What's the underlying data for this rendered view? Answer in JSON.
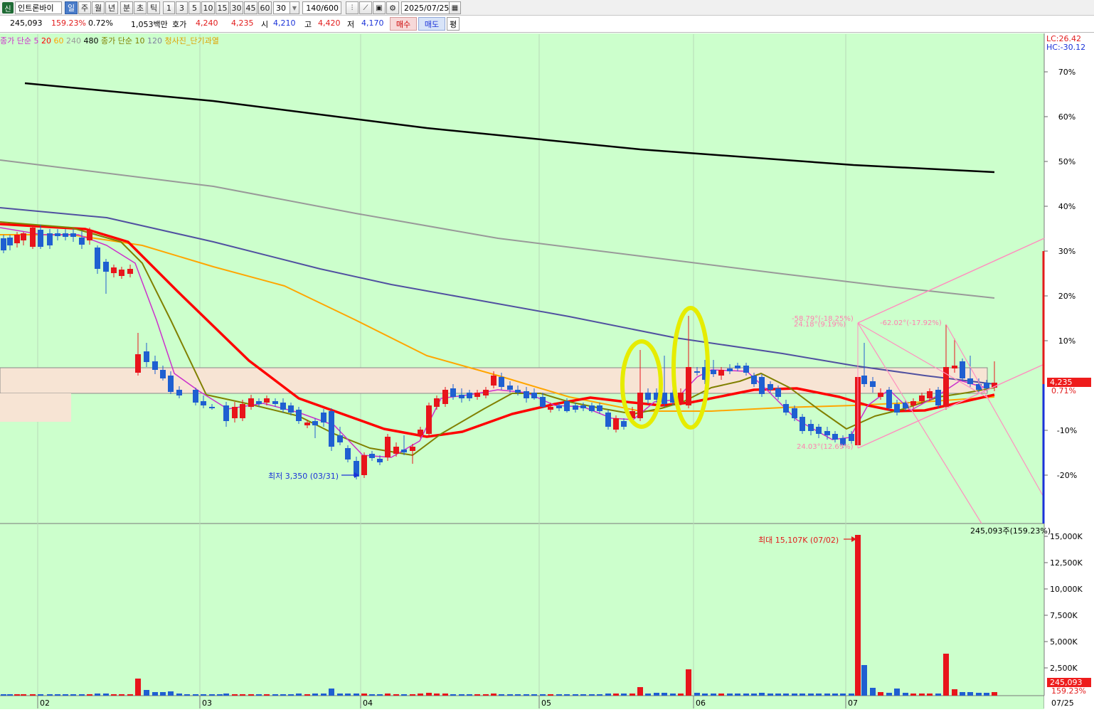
{
  "toolbar": {
    "credit_badge": "신",
    "stock_name": "인트론바이",
    "periods": [
      "일",
      "주",
      "월",
      "년",
      "분",
      "초",
      "틱"
    ],
    "selected_period": "일",
    "intervals": [
      "1",
      "3",
      "5",
      "10",
      "15",
      "30",
      "45",
      "60"
    ],
    "interval_value": "30",
    "count_value": "140",
    "count_total": "/600",
    "date_value": "2025/07/25"
  },
  "quote": {
    "volume": "245,093",
    "volume_ratio": "159.23%",
    "change_rate": "0.72%",
    "trade_amount": "1,053백만",
    "ask_label": "호가",
    "ask_price": "4,240",
    "bid_price": "4,235",
    "open_label": "시",
    "open": "4,210",
    "high_label": "고",
    "high": "4,420",
    "low_label": "저",
    "low": "4,170",
    "buy_label": "매수",
    "sell_label": "매도",
    "avg_label": "평"
  },
  "legend": {
    "ma_label": "종가 단순",
    "ma_periods": [
      {
        "text": "5",
        "color": "#cc2fcc"
      },
      {
        "text": "20",
        "color": "#ff0000"
      },
      {
        "text": "60",
        "color": "#ffa500"
      },
      {
        "text": "240",
        "color": "#999999"
      },
      {
        "text": "480",
        "color": "#000000"
      }
    ],
    "ma2_label": "종가 단순",
    "ma2_periods": [
      {
        "text": "10",
        "color": "#808000"
      },
      {
        "text": "120",
        "color": "#5050a0"
      }
    ],
    "signal_label": "청사진_단기과열"
  },
  "right_axis": {
    "lc_label": "LC:26.42",
    "hc_label": "HC:-30.12",
    "price_ticks": [
      "70%",
      "60%",
      "50%",
      "40%",
      "30%",
      "20%",
      "10%",
      "-10%",
      "-20%"
    ],
    "current_price": "4,235",
    "current_change": "0.71%",
    "volume_ticks": [
      "15,000K",
      "12,500K",
      "10,000K",
      "7,500K",
      "5,000K",
      "2,500K"
    ],
    "current_volume": "245,093",
    "current_volume_ratio": "159.23%",
    "volume_header": "245,093주(159.23%)"
  },
  "x_axis": {
    "months": [
      "02",
      "03",
      "04",
      "05",
      "06",
      "07"
    ],
    "last_date": "07/25"
  },
  "annotations": {
    "low_marker": "최저 3,350 (03/31)",
    "max_volume": "최대 15,107K (07/02)",
    "fib1": "-58.79°(-18.25%)",
    "fib2": "24.18°(9.19%)",
    "fib3": "-62.02°(-17.92%)",
    "fib4": "24.03°(12.69%)"
  },
  "colors": {
    "up": "#e8141b",
    "down": "#1f5fd1",
    "ma5": "#cc2fcc",
    "ma10": "#808000",
    "ma20": "#ff0000",
    "ma60": "#ffa500",
    "ma120": "#5050a0",
    "ma240": "#999999",
    "ma480": "#000000",
    "background": "#ccffcc",
    "highlight": "#e6ec00"
  }
}
